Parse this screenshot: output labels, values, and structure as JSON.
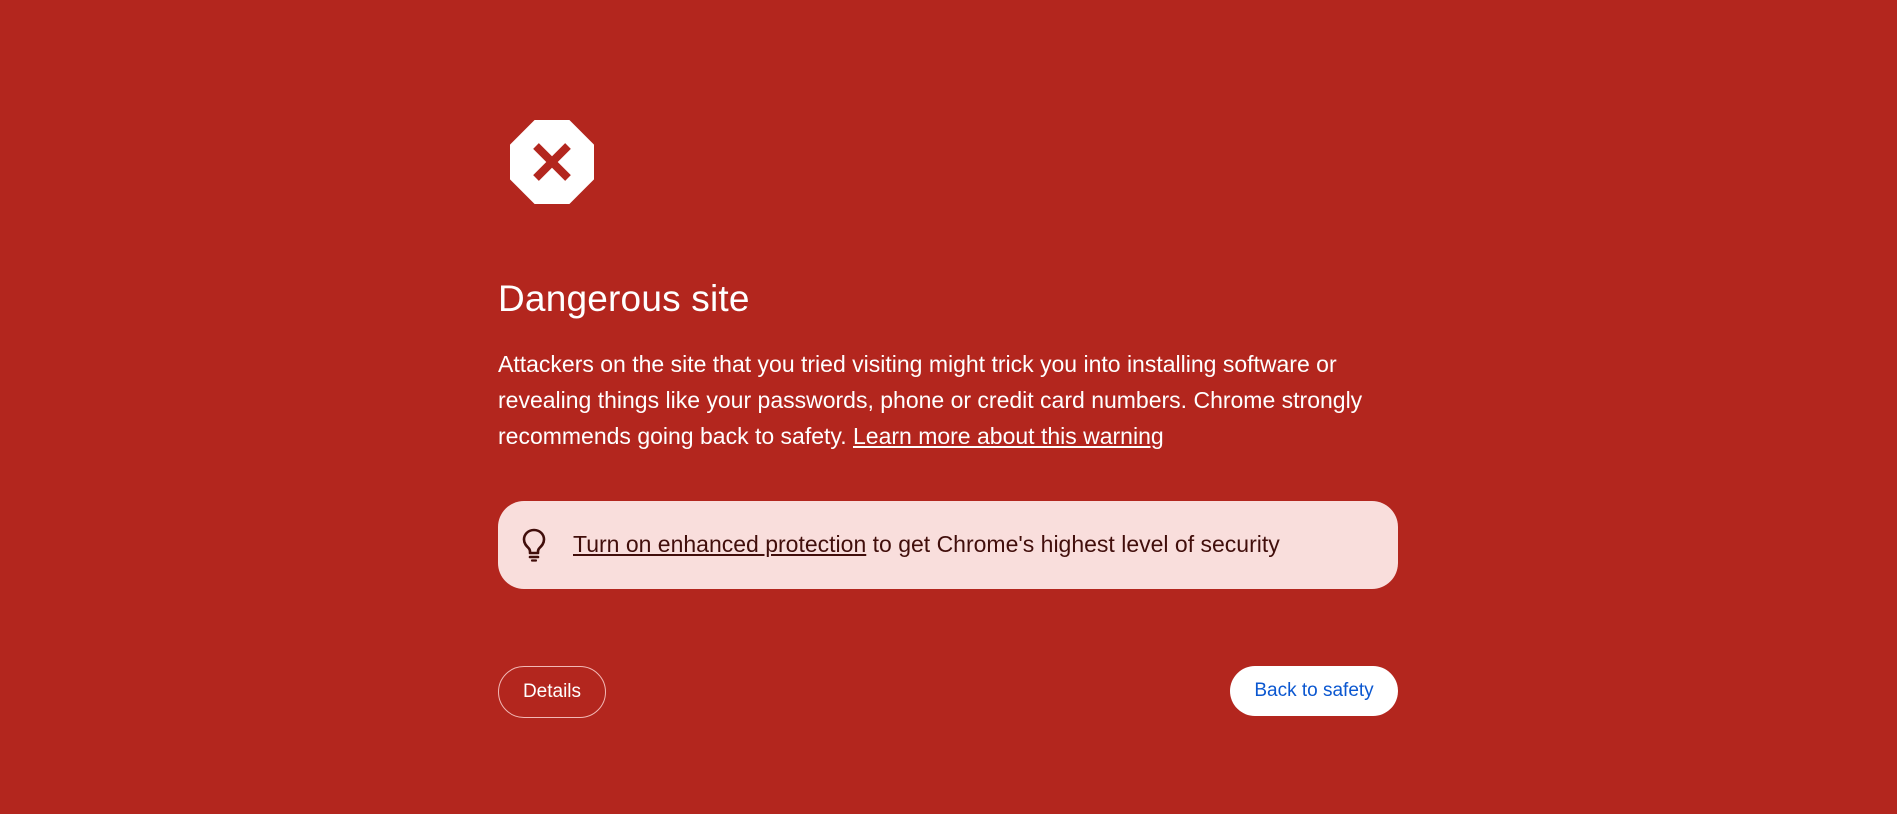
{
  "page": {
    "background_color": "#b3261e",
    "icon": "stop-octagon-x-icon"
  },
  "warning": {
    "title": "Dangerous site",
    "body_text": "Attackers on the site that you tried visiting might trick you into installing software or revealing things like your passwords, phone or credit card numbers. Chrome strongly recommends going back to safety.",
    "learn_more_link": "Learn more about this warning"
  },
  "promo": {
    "icon": "lightbulb-icon",
    "link_text": "Turn on enhanced protection",
    "suffix_text": "to get Chrome's highest level of security",
    "background_color": "#f9dedc"
  },
  "buttons": {
    "details_label": "Details",
    "back_label": "Back to safety",
    "back_text_color": "#0b57d0"
  }
}
